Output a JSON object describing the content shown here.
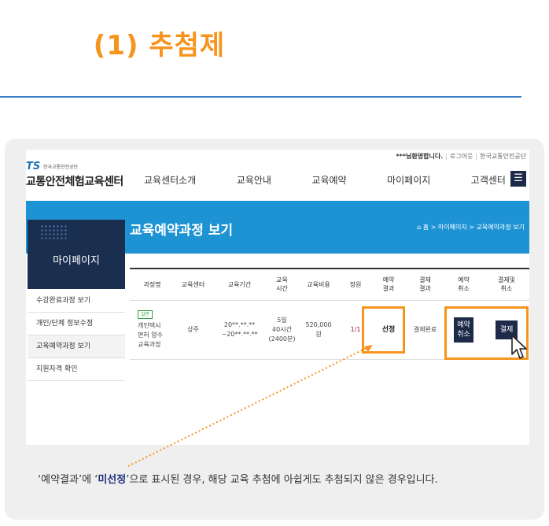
{
  "heading": "(1) 추첨제",
  "header": {
    "welcome_name": "***님",
    "welcome_text": "환영합니다.",
    "logout": "로그아웃",
    "org_link": "한국교통안전공단",
    "logo_ts": "TS",
    "logo_org": "한국교통안전공단",
    "logo_center": "교통안전체험교육센터",
    "menu_icon": "hamburger-icon",
    "nav": [
      "교육센터소개",
      "교육안내",
      "교육예약",
      "마이페이지",
      "고객센터"
    ]
  },
  "banner": {
    "title": "교육예약과정 보기",
    "breadcrumb": [
      "홈",
      "마이페이지",
      "교육예약과정 보기"
    ]
  },
  "sidebar": {
    "title": "마이페이지",
    "items": [
      {
        "label": "수강완료과정 보기",
        "active": false
      },
      {
        "label": "개인/단체 정보수정",
        "active": false
      },
      {
        "label": "교육예약과정 보기",
        "active": true
      },
      {
        "label": "지원자격 확인",
        "active": false
      }
    ]
  },
  "table": {
    "headers": [
      "과정명",
      "교육센터",
      "교육기간",
      "교육\n시간",
      "교육비용",
      "정원",
      "예약\n결과",
      "결제\n결과",
      "예약\n취소",
      "결제및\n취소"
    ],
    "row": {
      "tag": "일반",
      "course": "개인택시\n면허 양수\n교육과정",
      "center": "상주",
      "period": "20**.**.**\n~20**.**.**",
      "hours": "5일\n40시간\n(2400분)",
      "cost": "520,000\n원",
      "seats": "1/1",
      "result": "선정",
      "payment": "결제완료",
      "cancel_button": "예약\n취소",
      "pay_button": "결제"
    }
  },
  "caption": {
    "before": "‘예약결과’에 ‘",
    "highlight": "미선정",
    "after": "’으로 표시된 경우, 해당 교육 추첨에 아쉽게도 추첨되지 않은 경우입니다."
  },
  "colors": {
    "accent_orange": "#f7941d",
    "banner_blue": "#1e93d4",
    "navy": "#1d2a4a"
  }
}
